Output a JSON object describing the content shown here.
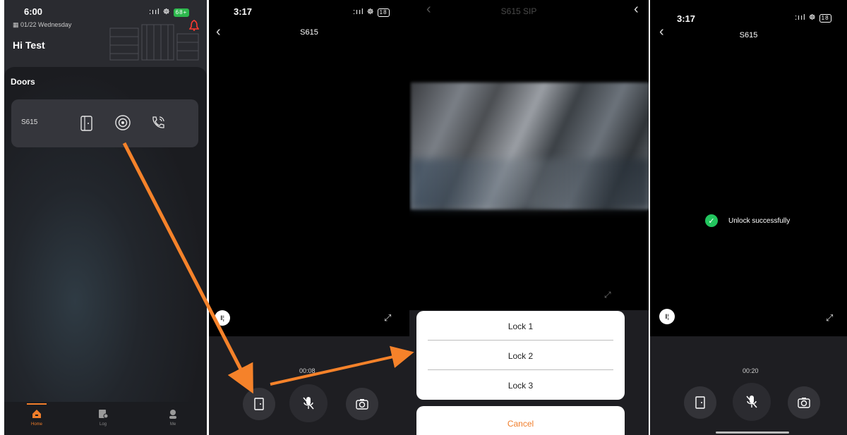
{
  "panel1": {
    "status": {
      "time": "6:00",
      "signal": ":ııl",
      "battery": "68+"
    },
    "date": "01/22 Wednesday",
    "greeting": "Hi Test",
    "section_title": "Doors",
    "door": {
      "name": "S615"
    },
    "tabs": [
      {
        "label": "Home"
      },
      {
        "label": "Log"
      },
      {
        "label": "Me"
      }
    ]
  },
  "panel2": {
    "status": {
      "time": "3:17",
      "signal": ":ııl",
      "battery": "18"
    },
    "title": "S615",
    "timer": "00:08"
  },
  "panel3": {
    "title": "S615 SIP",
    "locks": [
      "Lock 1",
      "Lock 2",
      "Lock 3"
    ],
    "cancel": "Cancel"
  },
  "panel4": {
    "status": {
      "time": "3:17",
      "signal": ":ııl",
      "battery": "18"
    },
    "title": "S615",
    "toast": "Unlock successfully",
    "timer": "00:20"
  },
  "colors": {
    "accent_orange": "#f07d2a",
    "success_green": "#22c55e",
    "arrow": "#f5822a"
  }
}
